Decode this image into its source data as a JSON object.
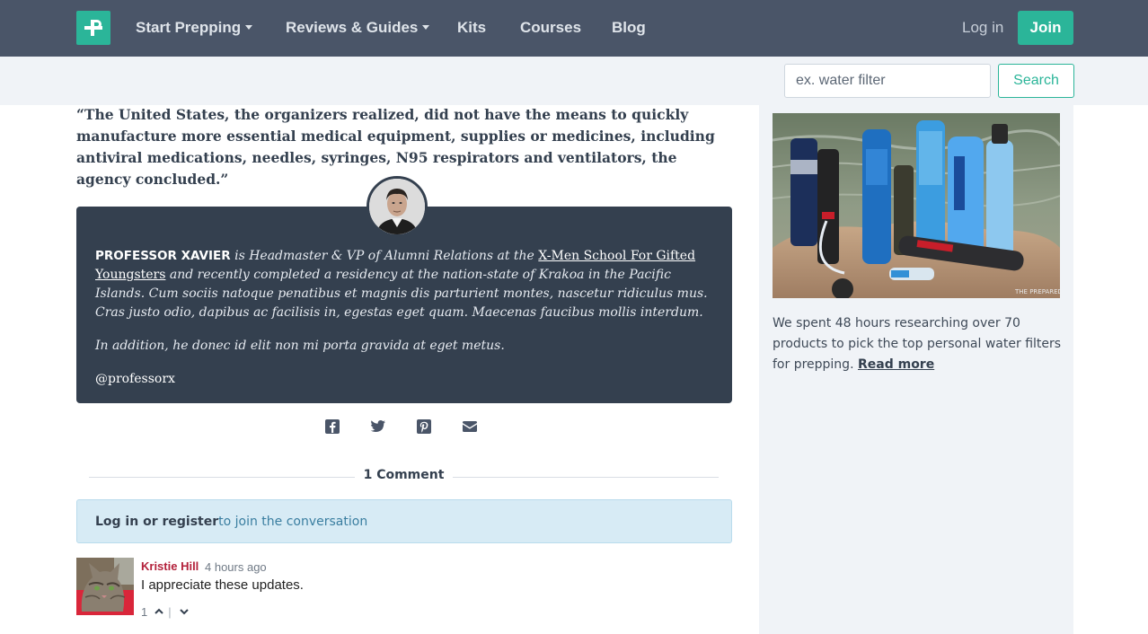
{
  "nav": {
    "items": [
      {
        "label": "Start Prepping",
        "dropdown": true
      },
      {
        "label": "Reviews & Guides",
        "dropdown": true
      },
      {
        "label": "Kits",
        "dropdown": false
      },
      {
        "label": "Courses",
        "dropdown": false
      },
      {
        "label": "Blog",
        "dropdown": false
      }
    ],
    "login": "Log in",
    "join": "Join",
    "brand_color": "#2bb599",
    "bar_color": "#4a5568"
  },
  "search": {
    "placeholder": "ex. water filter",
    "button": "Search"
  },
  "article": {
    "quote": "“The United States, the organizers realized, did not have the means to quickly manufacture more essential medical equipment, supplies or medicines, including antiviral medications, needles, syringes, N95 respirators and ventilators, the agency concluded.”"
  },
  "bio": {
    "name": "PROFESSOR XAVIER",
    "text_before_link": " is Headmaster & VP of Alumni Relations at the ",
    "link": "X-Men School For Gifted Youngsters",
    "text_after_link": " and recently completed a residency at the nation-state of Krakoa in the Pacific Islands. Cum sociis natoque penatibus et magnis dis parturient montes, nascetur ridiculus mus. Cras justo odio, dapibus ac facilisis in, egestas eget quam. Maecenas faucibus mollis interdum.",
    "paragraph2": "In addition, he donec id elit non mi porta gravida at eget metus.",
    "handle": "@professorx",
    "card_color": "#34404f"
  },
  "share": {
    "icons": [
      "facebook-icon",
      "twitter-icon",
      "pinterest-icon",
      "envelope-icon"
    ]
  },
  "comments": {
    "heading": "1 Comment",
    "join_prompt": {
      "link": "Log in or register",
      "rest": " to join the conversation"
    },
    "items": [
      {
        "author": "Kristie Hill",
        "time": "4 hours ago",
        "text": "I appreciate these updates.",
        "votes": "1"
      }
    ]
  },
  "sidebar": {
    "promo_text": "We spent 48 hours researching over 70 products to pick the top personal water filters for prepping. ",
    "read_more": "Read more",
    "image_watermark": "THE PREPARED"
  }
}
